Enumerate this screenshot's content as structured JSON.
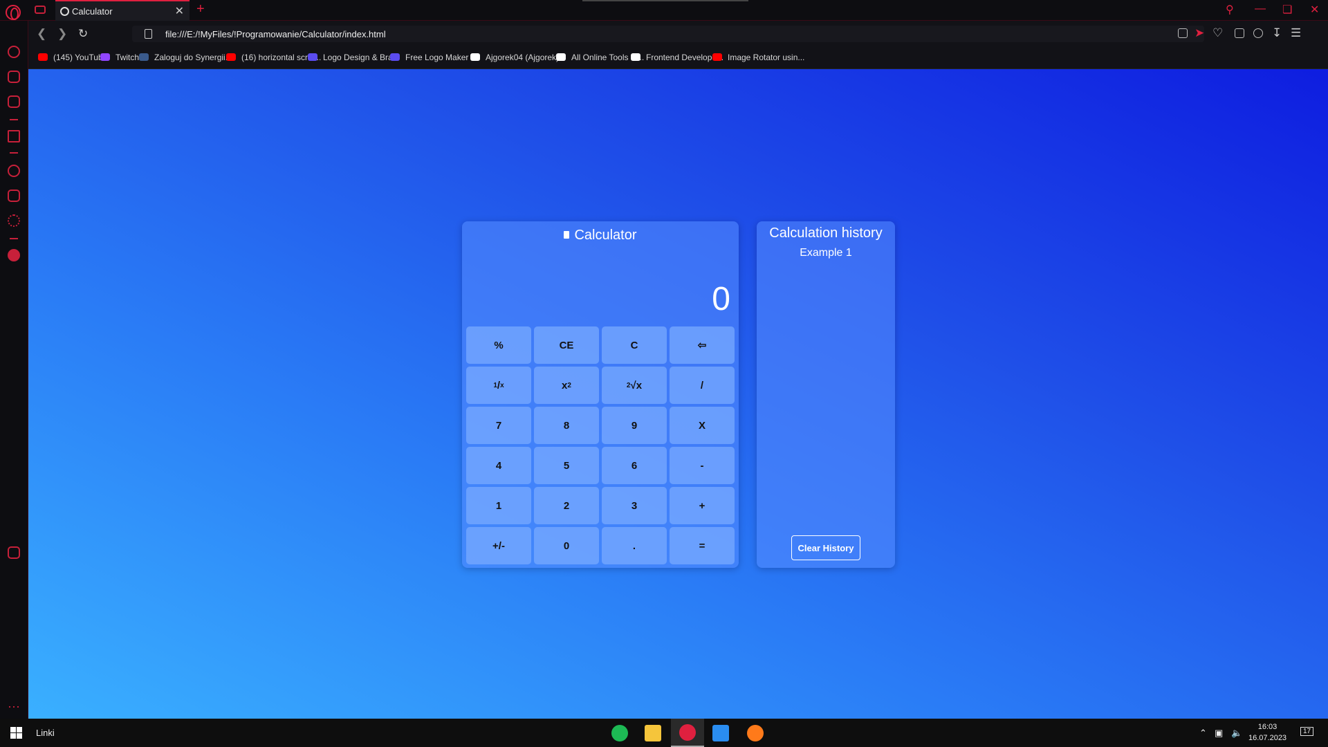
{
  "browser": {
    "tab_title": "Calculator",
    "new_tab": "+",
    "tab_close": "✕",
    "url": "file:///E:/!MyFiles/!Programowanie/Calculator/index.html",
    "accent_color": "#e0203f"
  },
  "bookmarks": [
    {
      "label": "(145) YouTube",
      "icon": "youtube-icon",
      "color": "#ff0000"
    },
    {
      "label": "Twitch",
      "icon": "twitch-icon",
      "color": "#9146ff"
    },
    {
      "label": "Zaloguj do Synergii...",
      "icon": "librus-icon",
      "color": "#3a5a8c"
    },
    {
      "label": "(16) horizontal scrol...",
      "icon": "youtube-icon",
      "color": "#ff0000"
    },
    {
      "label": "Logo Design & Bra...",
      "icon": "brand-icon",
      "color": "#5b4cf0"
    },
    {
      "label": "Free Logo Maker -...",
      "icon": "brand-icon",
      "color": "#5b4cf0"
    },
    {
      "label": "Ajgorek04 (Ajgorek)",
      "icon": "github-icon",
      "color": "#ffffff"
    },
    {
      "label": "All Online Tools in...",
      "icon": "tools-icon",
      "color": "#ffffff"
    },
    {
      "label": "Frontend Develope...",
      "icon": "frontend-icon",
      "color": "#ffffff"
    },
    {
      "label": "Image Rotator usin...",
      "icon": "youtube-icon",
      "color": "#ff0000"
    }
  ],
  "calculator": {
    "title": "Calculator",
    "display": "0",
    "keys": [
      {
        "label": "%",
        "name": "percent-key"
      },
      {
        "label": "CE",
        "name": "clear-entry-key"
      },
      {
        "label": "C",
        "name": "clear-key"
      },
      {
        "label": "⇦",
        "name": "backspace-key"
      },
      {
        "label": "1/x",
        "name": "reciprocal-key"
      },
      {
        "label": "x2",
        "name": "square-key"
      },
      {
        "label": "2√x",
        "name": "sqrt-key"
      },
      {
        "label": "/",
        "name": "divide-key"
      },
      {
        "label": "7",
        "name": "digit-7-key"
      },
      {
        "label": "8",
        "name": "digit-8-key"
      },
      {
        "label": "9",
        "name": "digit-9-key"
      },
      {
        "label": "X",
        "name": "multiply-key"
      },
      {
        "label": "4",
        "name": "digit-4-key"
      },
      {
        "label": "5",
        "name": "digit-5-key"
      },
      {
        "label": "6",
        "name": "digit-6-key"
      },
      {
        "label": "-",
        "name": "subtract-key"
      },
      {
        "label": "1",
        "name": "digit-1-key"
      },
      {
        "label": "2",
        "name": "digit-2-key"
      },
      {
        "label": "3",
        "name": "digit-3-key"
      },
      {
        "label": "+",
        "name": "add-key"
      },
      {
        "label": "+/-",
        "name": "negate-key"
      },
      {
        "label": "0",
        "name": "digit-0-key"
      },
      {
        "label": ".",
        "name": "decimal-key"
      },
      {
        "label": "=",
        "name": "equals-key"
      }
    ]
  },
  "history": {
    "title": "Calculation history",
    "entries": [
      "Example 1"
    ],
    "clear_label": "Clear History"
  },
  "taskbar": {
    "links_label": "Linki",
    "apps": [
      {
        "name": "spotify-icon",
        "color": "#1db954"
      },
      {
        "name": "file-explorer-icon",
        "color": "#f5c53b"
      },
      {
        "name": "opera-icon",
        "color": "#e0203f"
      },
      {
        "name": "vscode-icon",
        "color": "#2a8df0"
      },
      {
        "name": "firefox-icon",
        "color": "#ff7a1a"
      }
    ],
    "time": "16:03",
    "date": "16.07.2023",
    "notification_count": "17"
  }
}
